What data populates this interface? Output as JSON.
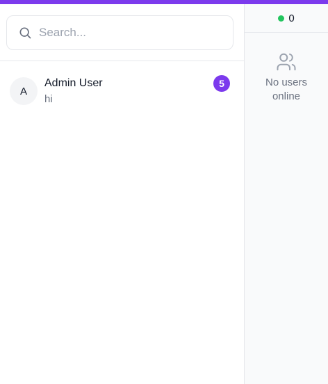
{
  "search": {
    "placeholder": "Search...",
    "value": "",
    "icon": "search-icon"
  },
  "chats": [
    {
      "avatar_initial": "A",
      "name": "Admin User",
      "preview": "hi",
      "unread": "5"
    }
  ],
  "online_panel": {
    "count": "0",
    "status_color": "#22c55e",
    "icon": "users-icon",
    "empty_line1": "No users",
    "empty_line2": "online"
  },
  "colors": {
    "accent": "#7c3aed",
    "online": "#22c55e"
  }
}
